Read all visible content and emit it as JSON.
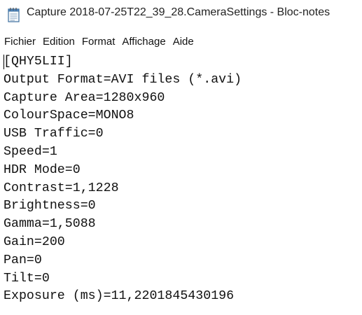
{
  "window": {
    "title": "Capture 2018-07-25T22_39_28.CameraSettings - Bloc-notes",
    "app_icon": "notepad-icon"
  },
  "menu": {
    "items": [
      {
        "label": "Fichier"
      },
      {
        "label": "Edition"
      },
      {
        "label": "Format"
      },
      {
        "label": "Affichage"
      },
      {
        "label": "Aide"
      }
    ]
  },
  "document": {
    "lines": [
      "[QHY5LII]",
      "Output Format=AVI files (*.avi)",
      "Capture Area=1280x960",
      "ColourSpace=MONO8",
      "USB Traffic=0",
      "Speed=1",
      "HDR Mode=0",
      "Contrast=1,1228",
      "Brightness=0",
      "Gamma=1,5088",
      "Gain=200",
      "Pan=0",
      "Tilt=0",
      "Exposure (ms)=11,2201845430196"
    ]
  }
}
